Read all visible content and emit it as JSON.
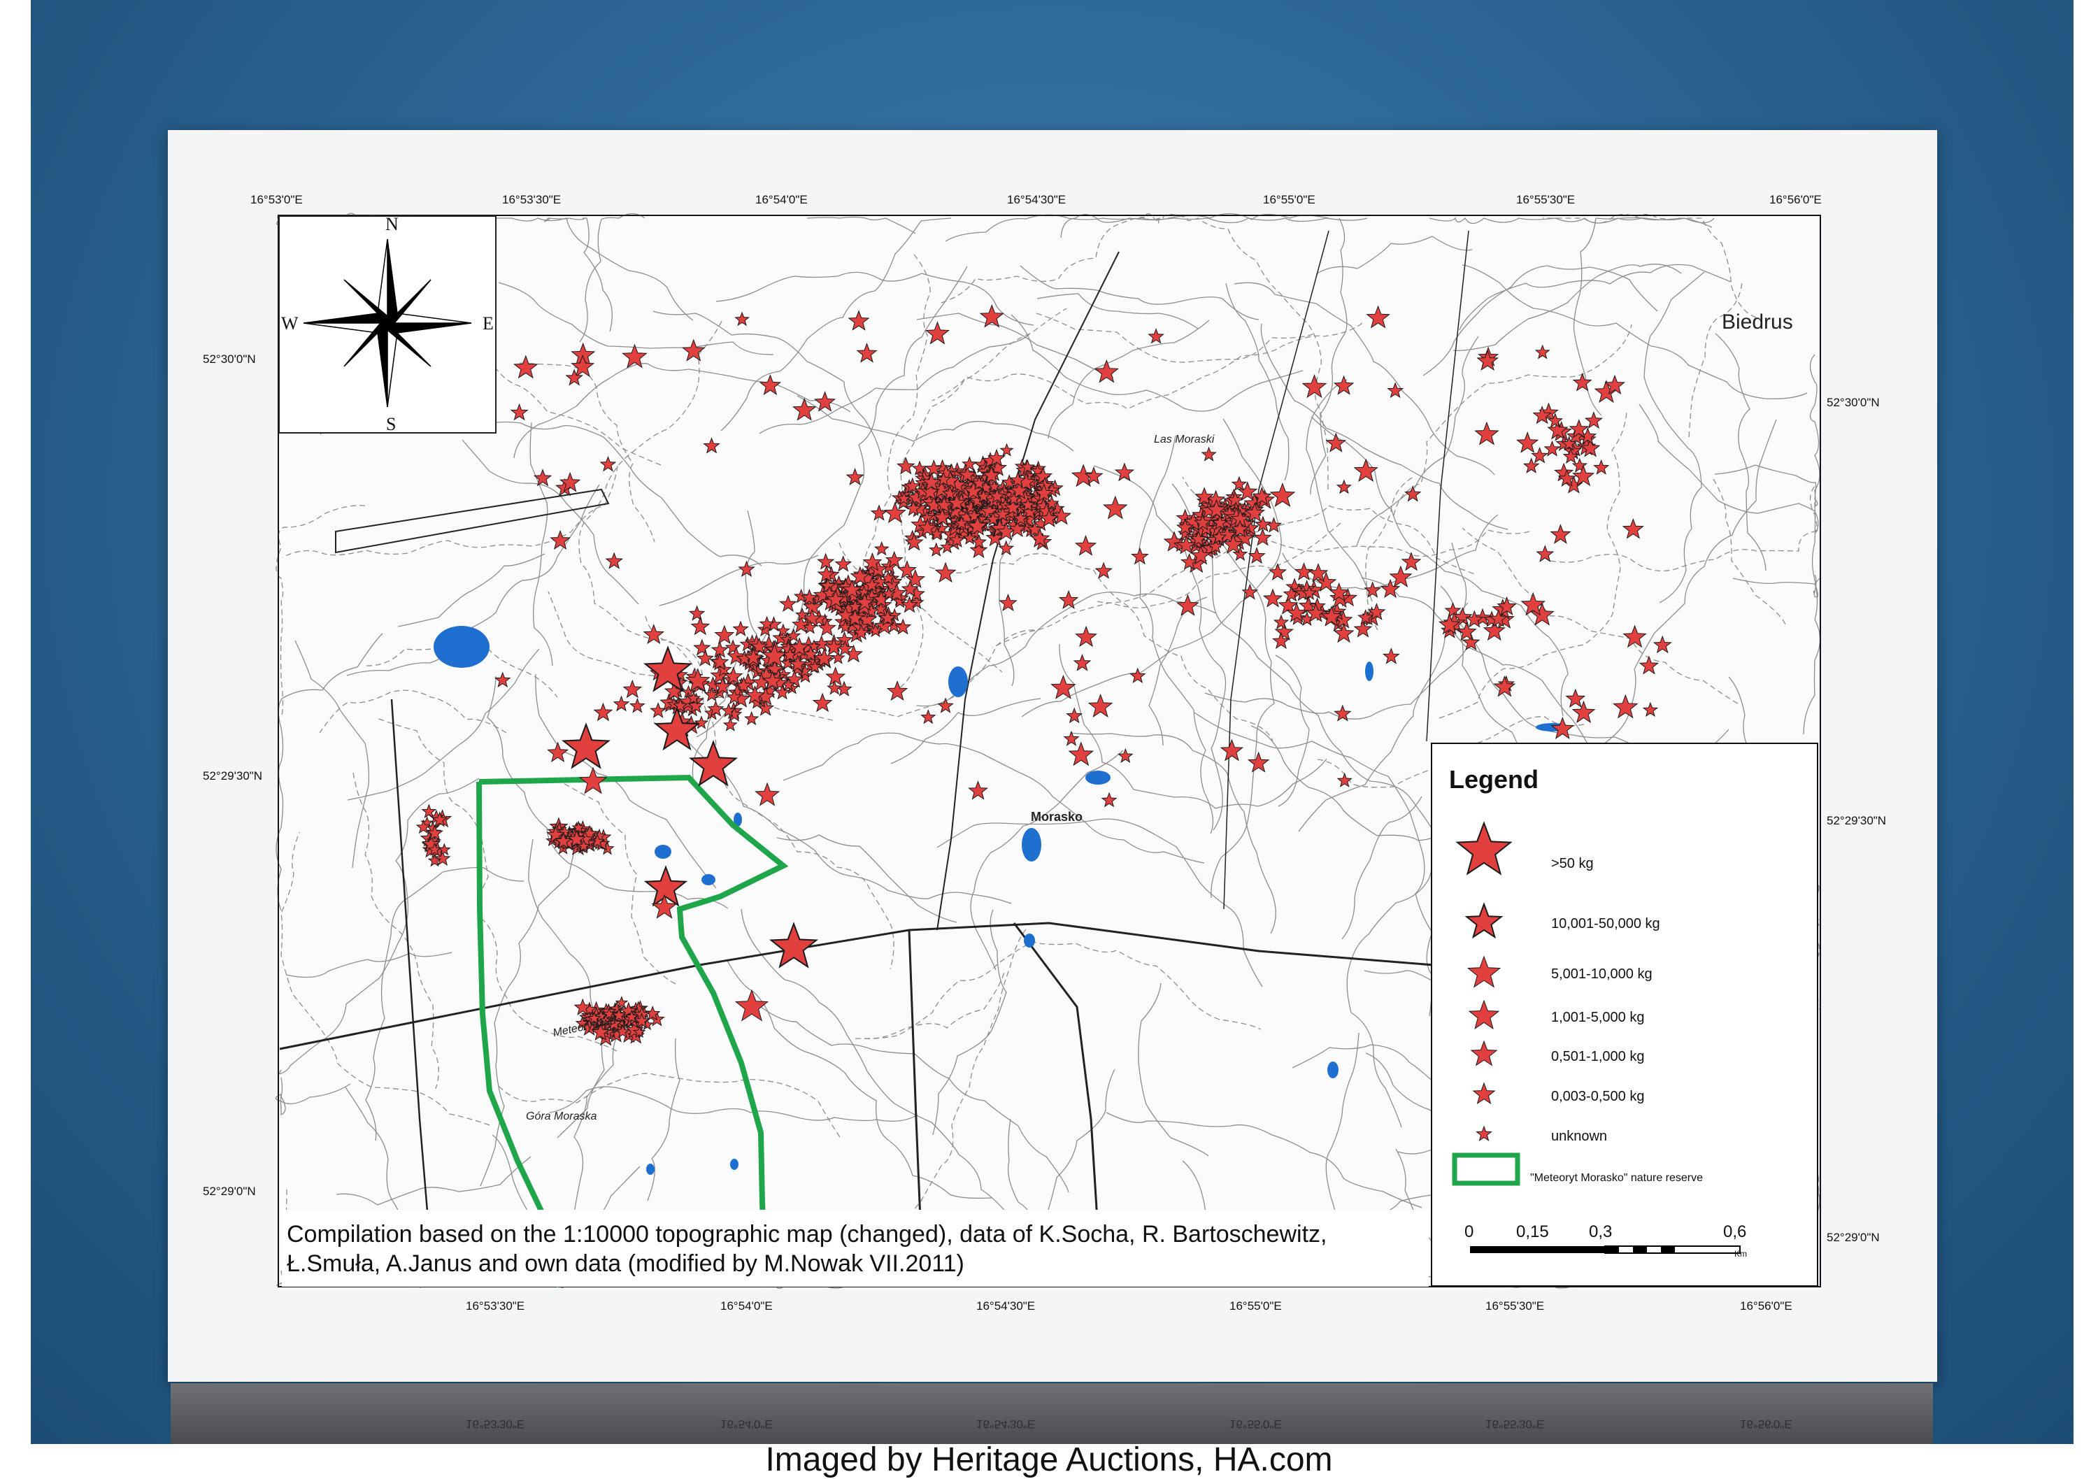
{
  "colors": {
    "background": "#2c6594",
    "paper": "#f4f5f7",
    "star_fill": "#e2403f",
    "star_stroke": "#1a1a1a",
    "reserve_outline": "#1fa64a",
    "water": "#1f6fd1"
  },
  "map": {
    "top_coords": [
      "16°53'0\"E",
      "16°53'30\"E",
      "16°54'0\"E",
      "16°54'30\"E",
      "16°55'0\"E",
      "16°55'30\"E",
      "16°56'0\"E"
    ],
    "bottom_coords": [
      "16°53'30\"E",
      "16°54'0\"E",
      "16°54'30\"E",
      "16°55'0\"E",
      "16°55'30\"E",
      "16°56'0\"E"
    ],
    "left_coords": [
      "52°30'0\"N",
      "52°29'30\"N",
      "52°29'0\"N"
    ],
    "right_coords": [
      "52°30'0\"N",
      "52°29'30\"N",
      "52°29'0\"N"
    ],
    "reflected_coords": [
      "16°53'30\"E",
      "16°54'0\"E",
      "16°54'30\"E",
      "16°55'0\"E",
      "16°55'30\"E",
      "16°56'0\"E"
    ],
    "places": {
      "biedrus": "Biedrus",
      "morasko": "Morasko",
      "las_morasko": "Las Moraski",
      "gora_morasko": "Góra Moraska",
      "meteorytowa": "Meteorytowa"
    },
    "compass": {
      "n": "N",
      "s": "S",
      "e": "E",
      "w": "W",
      "icon": "compass-rose-icon"
    }
  },
  "caption": {
    "line1": "Compilation based on the 1:10000 topographic map (changed), data of K.Socha, R. Bartoschewitz,",
    "line2": "Ł.Smuła, A.Janus and own data (modified by M.Nowak VII.2011)"
  },
  "legend": {
    "title": "Legend",
    "items": [
      {
        "label": ">50 kg",
        "icon": "star-icon"
      },
      {
        "label": "10,001-50,000 kg",
        "icon": "star-icon"
      },
      {
        "label": "5,001-10,000 kg",
        "icon": "star-icon"
      },
      {
        "label": "1,001-5,000 kg",
        "icon": "star-icon"
      },
      {
        "label": "0,501-1,000 kg",
        "icon": "star-icon"
      },
      {
        "label": "0,003-0,500 kg",
        "icon": "star-icon"
      },
      {
        "label": "unknown",
        "icon": "star-icon"
      },
      {
        "label": "\"Meteoryt Morasko\" nature reserve",
        "icon": "reserve-outline-icon"
      }
    ],
    "scale": {
      "ticks": [
        "0",
        "0,15",
        "0,3",
        "0,6"
      ],
      "unit": "Km"
    }
  },
  "credit": "Imaged by Heritage Auctions, HA.com"
}
